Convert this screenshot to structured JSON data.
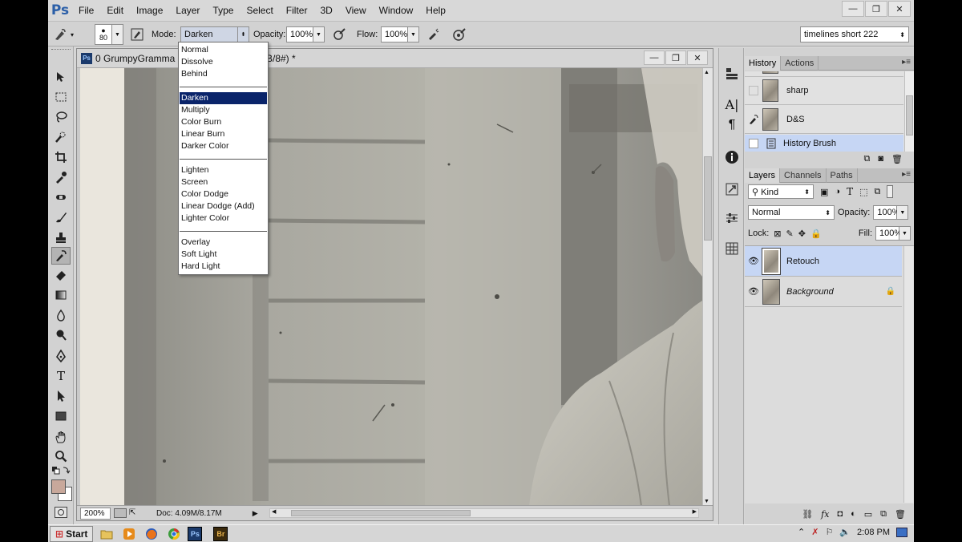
{
  "app": {
    "logo": "Ps"
  },
  "menu": [
    "File",
    "Edit",
    "Image",
    "Layer",
    "Type",
    "Select",
    "Filter",
    "3D",
    "View",
    "Window",
    "Help"
  ],
  "window_controls": {
    "minimize": "—",
    "restore": "❐",
    "close": "✕"
  },
  "options": {
    "brush_size": "80",
    "mode_label": "Mode:",
    "mode_value": "Darken",
    "opacity_label": "Opacity:",
    "opacity_value": "100%",
    "flow_label": "Flow:",
    "flow_value": "100%",
    "workspace_value": "timelines short 222"
  },
  "blend_modes": {
    "groups": [
      [
        "Normal",
        "Dissolve",
        "Behind"
      ],
      [
        "Darken",
        "Multiply",
        "Color Burn",
        "Linear Burn",
        "Darker Color"
      ],
      [
        "Lighten",
        "Screen",
        "Color Dodge",
        "Linear Dodge (Add)",
        "Lighter Color"
      ],
      [
        "Overlay",
        "Soft Light",
        "Hard Light"
      ]
    ],
    "selected": "Darken"
  },
  "document": {
    "title_left": "0 GrumpyGramma 1.jp",
    "title_right": "B/8#) *",
    "zoom": "200%",
    "doc_info": "Doc: 4.09M/8.17M"
  },
  "history_panel": {
    "tabs": [
      "History",
      "Actions"
    ],
    "items": [
      {
        "name": "sharp"
      },
      {
        "name": "D&S"
      },
      {
        "name": "History Brush"
      }
    ]
  },
  "layers_panel": {
    "tabs": [
      "Layers",
      "Channels",
      "Paths"
    ],
    "filter_kind": "Kind",
    "blend_mode": "Normal",
    "opacity_label": "Opacity:",
    "opacity_value": "100%",
    "lock_label": "Lock:",
    "fill_label": "Fill:",
    "fill_value": "100%",
    "layers": [
      {
        "name": "Retouch"
      },
      {
        "name": "Background"
      }
    ]
  },
  "colors": {
    "foreground": "#c8a89b",
    "background": "#ffffff",
    "selection": "#0a246a",
    "layer_highlight": "#c6d6f4"
  },
  "taskbar": {
    "start_label": "Start",
    "clock": "2:08 PM"
  }
}
